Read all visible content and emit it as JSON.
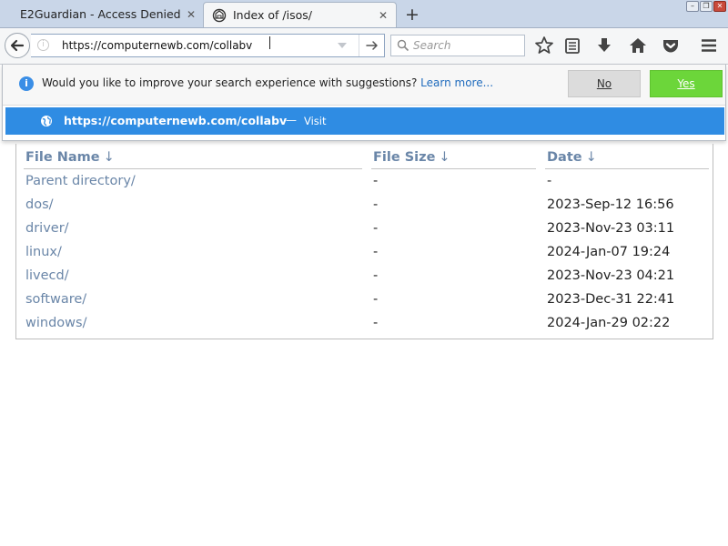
{
  "tabs": [
    {
      "title": "E2Guardian - Access Denied",
      "active": false
    },
    {
      "title": "Index of /isos/",
      "active": true
    }
  ],
  "navbar": {
    "url_value": "https://computernewb.com/collabv",
    "search_placeholder": "Search"
  },
  "suggestions": {
    "prompt": "Would you like to improve your search experience with suggestions?",
    "learn_more": "Learn more...",
    "no_label": "No",
    "yes_label": "Yes",
    "item_url": "https://computernewb.com/collabv",
    "item_separator": "—",
    "item_action": "Visit"
  },
  "listing": {
    "headers": {
      "name": "File Name",
      "size": "File Size",
      "date": "Date",
      "sort_arrow": "↓"
    },
    "rows": [
      {
        "name": "Parent directory/",
        "size": "-",
        "date": "-"
      },
      {
        "name": "dos/",
        "size": "-",
        "date": "2023-Sep-12 16:56"
      },
      {
        "name": "driver/",
        "size": "-",
        "date": "2023-Nov-23 03:11"
      },
      {
        "name": "linux/",
        "size": "-",
        "date": "2024-Jan-07 19:24"
      },
      {
        "name": "livecd/",
        "size": "-",
        "date": "2023-Nov-23 04:21"
      },
      {
        "name": "software/",
        "size": "-",
        "date": "2023-Dec-31 22:41"
      },
      {
        "name": "windows/",
        "size": "-",
        "date": "2024-Jan-29 02:22"
      }
    ]
  },
  "colors": {
    "accent_blue": "#2f8ce3",
    "yes_green": "#6cd63a",
    "link_color": "#6a86a8"
  },
  "icons": [
    "back-arrow-icon",
    "info-icon",
    "dropdown-arrow-icon",
    "go-arrow-icon",
    "search-icon",
    "bookmark-star-icon",
    "reading-list-icon",
    "download-icon",
    "home-icon",
    "pocket-icon",
    "menu-icon",
    "globe-icon",
    "close-icon",
    "new-tab-icon"
  ]
}
